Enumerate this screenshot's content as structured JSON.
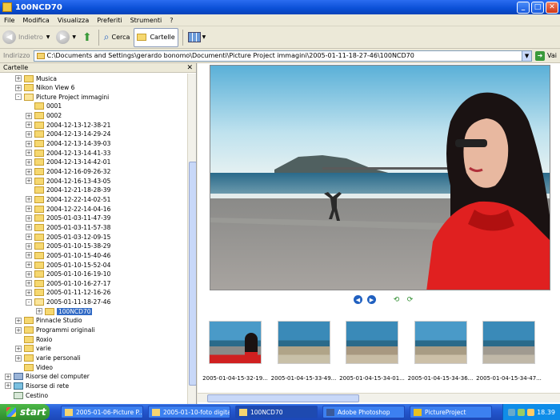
{
  "window": {
    "title": "100NCD70"
  },
  "menu": [
    "File",
    "Modifica",
    "Visualizza",
    "Preferiti",
    "Strumenti",
    "?"
  ],
  "toolbar": {
    "back": "Indietro",
    "search": "Cerca",
    "folders": "Cartelle"
  },
  "address": {
    "label": "Indirizzo",
    "value": "C:\\Documents and Settings\\gerardo bonomo\\Documenti\\Picture Project immagini\\2005-01-11-18-27-46\\100NCD70",
    "go": "Vai"
  },
  "folders_pane": {
    "title": "Cartelle",
    "items": [
      {
        "label": "Musica",
        "indent": 1,
        "exp": "+"
      },
      {
        "label": "Nikon View 6",
        "indent": 1,
        "exp": "+"
      },
      {
        "label": "Picture Project immagini",
        "indent": 1,
        "exp": "-",
        "open": true
      },
      {
        "label": "0001",
        "indent": 2,
        "exp": ""
      },
      {
        "label": "0002",
        "indent": 2,
        "exp": "+"
      },
      {
        "label": "2004-12-13-12-38-21",
        "indent": 2,
        "exp": "+"
      },
      {
        "label": "2004-12-13-14-29-24",
        "indent": 2,
        "exp": "+"
      },
      {
        "label": "2004-12-13-14-39-03",
        "indent": 2,
        "exp": "+"
      },
      {
        "label": "2004-12-13-14-41-33",
        "indent": 2,
        "exp": "+"
      },
      {
        "label": "2004-12-13-14-42-01",
        "indent": 2,
        "exp": "+"
      },
      {
        "label": "2004-12-16-09-26-32",
        "indent": 2,
        "exp": "+"
      },
      {
        "label": "2004-12-16-13-43-05",
        "indent": 2,
        "exp": "+"
      },
      {
        "label": "2004-12-21-18-28-39",
        "indent": 2,
        "exp": ""
      },
      {
        "label": "2004-12-22-14-02-51",
        "indent": 2,
        "exp": "+"
      },
      {
        "label": "2004-12-22-14-04-16",
        "indent": 2,
        "exp": "+"
      },
      {
        "label": "2005-01-03-11-47-39",
        "indent": 2,
        "exp": "+"
      },
      {
        "label": "2005-01-03-11-57-38",
        "indent": 2,
        "exp": "+"
      },
      {
        "label": "2005-01-03-12-09-15",
        "indent": 2,
        "exp": "+"
      },
      {
        "label": "2005-01-10-15-38-29",
        "indent": 2,
        "exp": "+"
      },
      {
        "label": "2005-01-10-15-40-46",
        "indent": 2,
        "exp": "+"
      },
      {
        "label": "2005-01-10-15-52-04",
        "indent": 2,
        "exp": "+"
      },
      {
        "label": "2005-01-10-16-19-10",
        "indent": 2,
        "exp": "+"
      },
      {
        "label": "2005-01-10-16-27-17",
        "indent": 2,
        "exp": "+"
      },
      {
        "label": "2005-01-11-12-16-26",
        "indent": 2,
        "exp": "+"
      },
      {
        "label": "2005-01-11-18-27-46",
        "indent": 2,
        "exp": "-",
        "open": true
      },
      {
        "label": "100NCD70",
        "indent": 3,
        "exp": "+",
        "selected": true
      },
      {
        "label": "Pinnacle Studio",
        "indent": 1,
        "exp": "+"
      },
      {
        "label": "Programmi originali",
        "indent": 1,
        "exp": "+"
      },
      {
        "label": "Roxio",
        "indent": 1,
        "exp": ""
      },
      {
        "label": "varie",
        "indent": 1,
        "exp": "+"
      },
      {
        "label": "varie personali",
        "indent": 1,
        "exp": "+"
      },
      {
        "label": "Video",
        "indent": 1,
        "exp": ""
      },
      {
        "label": "Risorse del computer",
        "indent": 0,
        "exp": "+",
        "icon": "computer-icon"
      },
      {
        "label": "Risorse di rete",
        "indent": 0,
        "exp": "+",
        "icon": "network-icon"
      },
      {
        "label": "Cestino",
        "indent": 0,
        "exp": "",
        "icon": "recycle-bin-icon"
      }
    ]
  },
  "thumbnails": [
    {
      "caption": "2005-01-04-15-32-19..."
    },
    {
      "caption": "2005-01-04-15-33-49..."
    },
    {
      "caption": "2005-01-04-15-34-01..."
    },
    {
      "caption": "2005-01-04-15-34-36..."
    },
    {
      "caption": "2005-01-04-15-34-47..."
    }
  ],
  "taskbar": {
    "start": "start",
    "tasks": [
      {
        "label": "2005-01-06-Picture P..."
      },
      {
        "label": "2005-01-10-foto digitali"
      },
      {
        "label": "100NCD70"
      },
      {
        "label": "Adobe Photoshop"
      },
      {
        "label": "PictureProject"
      }
    ],
    "clock": "18.39"
  }
}
